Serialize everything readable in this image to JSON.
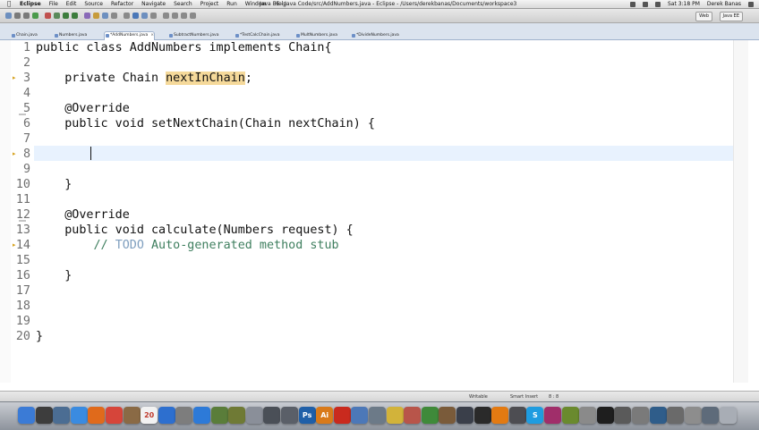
{
  "menubar": {
    "apple": "",
    "items": [
      "Eclipse",
      "File",
      "Edit",
      "Source",
      "Refactor",
      "Navigate",
      "Search",
      "Project",
      "Run",
      "Window",
      "Help"
    ],
    "window_title": "Java EE - Java Code/src/AddNumbers.java - Eclipse - /Users/derekbanas/Documents/workspace3",
    "clock": "Sat 3:18 PM",
    "user": "Derek Banas"
  },
  "toolbar": {
    "perspectives": [
      "Web",
      "Java EE"
    ]
  },
  "tabs": [
    {
      "label": "Chain.java",
      "active": false
    },
    {
      "label": "Numbers.java",
      "active": false
    },
    {
      "label": "*AddNumbers.java",
      "active": true
    },
    {
      "label": "SubtractNumbers.java",
      "active": false
    },
    {
      "label": "*TestCalcChain.java",
      "active": false
    },
    {
      "label": "MultNumbers.java",
      "active": false
    },
    {
      "label": "*DivideNumbers.java",
      "active": false
    }
  ],
  "editor": {
    "current_line": 8,
    "lines": [
      {
        "n": "1",
        "parts": [
          {
            "t": "public class AddNumbers implements Chain{",
            "c": ""
          }
        ]
      },
      {
        "n": "2",
        "parts": []
      },
      {
        "n": "3",
        "parts": [
          {
            "t": "    private Chain ",
            "c": ""
          },
          {
            "t": "nextInChain",
            "c": "hl"
          },
          {
            "t": ";",
            "c": ""
          }
        ]
      },
      {
        "n": "4",
        "parts": []
      },
      {
        "n": "5",
        "parts": [
          {
            "t": "    @Override",
            "c": ""
          }
        ]
      },
      {
        "n": "6",
        "parts": [
          {
            "t": "    public void setNextChain(Chain nextChain) {",
            "c": ""
          }
        ]
      },
      {
        "n": "7",
        "parts": []
      },
      {
        "n": "8",
        "parts": []
      },
      {
        "n": "9",
        "parts": []
      },
      {
        "n": "10",
        "parts": [
          {
            "t": "    }",
            "c": ""
          }
        ]
      },
      {
        "n": "11",
        "parts": []
      },
      {
        "n": "12",
        "parts": [
          {
            "t": "    @Override",
            "c": ""
          }
        ]
      },
      {
        "n": "13",
        "parts": [
          {
            "t": "    public void calculate(Numbers request) {",
            "c": ""
          }
        ]
      },
      {
        "n": "14",
        "parts": [
          {
            "t": "        // ",
            "c": "comment"
          },
          {
            "t": "TODO",
            "c": "todo"
          },
          {
            "t": " Auto-generated method stub",
            "c": "comment"
          }
        ]
      },
      {
        "n": "15",
        "parts": []
      },
      {
        "n": "16",
        "parts": [
          {
            "t": "    }",
            "c": ""
          }
        ]
      },
      {
        "n": "17",
        "parts": []
      },
      {
        "n": "18",
        "parts": []
      },
      {
        "n": "19",
        "parts": []
      },
      {
        "n": "20",
        "parts": [
          {
            "t": "}",
            "c": ""
          }
        ]
      }
    ]
  },
  "statusbar": {
    "mode": "Writable",
    "insert": "Smart Insert",
    "position": "8 : 8"
  },
  "dock": {
    "apps": [
      {
        "name": "finder-icon",
        "color": "#3b7bd6",
        "glyph": ""
      },
      {
        "name": "dashboard-icon",
        "color": "#3d3d3d",
        "glyph": ""
      },
      {
        "name": "mission-control-icon",
        "color": "#4b6d93",
        "glyph": ""
      },
      {
        "name": "app-store-icon",
        "color": "#3a8be0",
        "glyph": ""
      },
      {
        "name": "firefox-icon",
        "color": "#e06a1b",
        "glyph": ""
      },
      {
        "name": "chrome-icon",
        "color": "#d6453a",
        "glyph": ""
      },
      {
        "name": "address-book-icon",
        "color": "#8a6a45",
        "glyph": ""
      },
      {
        "name": "calendar-icon",
        "color": "#f2f2f2",
        "glyph": "20"
      },
      {
        "name": "itunes-icon",
        "color": "#2d6fcf",
        "glyph": ""
      },
      {
        "name": "system-preferences-icon",
        "color": "#7d7d7d",
        "glyph": ""
      },
      {
        "name": "safari-icon",
        "color": "#2d7ad8",
        "glyph": ""
      },
      {
        "name": "image-app-icon",
        "color": "#5a7d3a",
        "glyph": ""
      },
      {
        "name": "utility-icon",
        "color": "#6f7a35",
        "glyph": ""
      },
      {
        "name": "preview-icon",
        "color": "#8a8f99",
        "glyph": ""
      },
      {
        "name": "tool-icon",
        "color": "#4a4f57",
        "glyph": ""
      },
      {
        "name": "media-icon",
        "color": "#5a5f68",
        "glyph": ""
      },
      {
        "name": "photoshop-icon",
        "color": "#1f5fa8",
        "glyph": "Ps"
      },
      {
        "name": "illustrator-icon",
        "color": "#d97a1a",
        "glyph": "Ai"
      },
      {
        "name": "acrobat-icon",
        "color": "#c92a1e",
        "glyph": ""
      },
      {
        "name": "document-icon",
        "color": "#4c78b8",
        "glyph": ""
      },
      {
        "name": "photo-app-icon",
        "color": "#6c7a88",
        "glyph": ""
      },
      {
        "name": "color-app-icon",
        "color": "#d2b33a",
        "glyph": ""
      },
      {
        "name": "paint-icon",
        "color": "#b8554a",
        "glyph": ""
      },
      {
        "name": "game-icon",
        "color": "#3f8a3a",
        "glyph": ""
      },
      {
        "name": "box-icon",
        "color": "#7a5b3a",
        "glyph": ""
      },
      {
        "name": "code-icon",
        "color": "#3a3f4a",
        "glyph": ""
      },
      {
        "name": "clapper-icon",
        "color": "#2a2a2a",
        "glyph": ""
      },
      {
        "name": "vlc-icon",
        "color": "#e37a12",
        "glyph": ""
      },
      {
        "name": "tool-2-icon",
        "color": "#4d4d52",
        "glyph": ""
      },
      {
        "name": "skype-icon",
        "color": "#1f9ce0",
        "glyph": "S"
      },
      {
        "name": "app-icon",
        "color": "#a02e6a",
        "glyph": ""
      },
      {
        "name": "app-2-icon",
        "color": "#6a8a2e",
        "glyph": ""
      },
      {
        "name": "app-3-icon",
        "color": "#8a8a8a",
        "glyph": ""
      },
      {
        "name": "terminal-icon",
        "color": "#1e1e1e",
        "glyph": ""
      },
      {
        "name": "app-4-icon",
        "color": "#5a5a5a",
        "glyph": ""
      },
      {
        "name": "app-5-icon",
        "color": "#7a7a7a",
        "glyph": ""
      },
      {
        "name": "app-6-icon",
        "color": "#2f5d8a",
        "glyph": ""
      },
      {
        "name": "app-7-icon",
        "color": "#6a6a6a",
        "glyph": ""
      },
      {
        "name": "app-8-icon",
        "color": "#8d8d8d",
        "glyph": ""
      },
      {
        "name": "app-9-icon",
        "color": "#5e6b7a",
        "glyph": ""
      },
      {
        "name": "trash-icon",
        "color": "#a8adb5",
        "glyph": ""
      }
    ]
  }
}
